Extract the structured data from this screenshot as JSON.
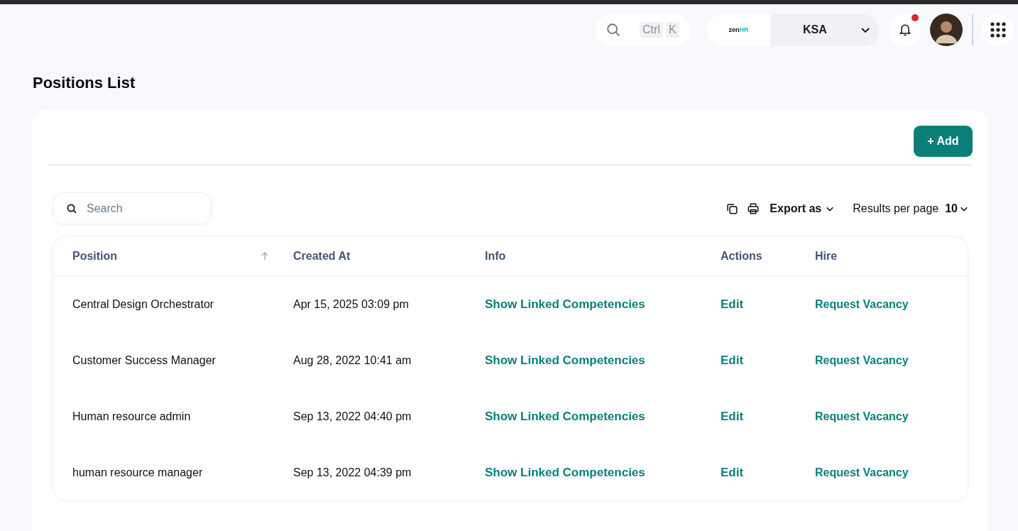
{
  "topbar": {
    "search_shortcut": [
      "Ctrl",
      "K"
    ],
    "logo": [
      "zen",
      "HR"
    ],
    "country": "KSA",
    "notifications": {
      "unread": true
    }
  },
  "page_title": "Positions List",
  "add_button": "+ Add",
  "search": {
    "placeholder": "Search"
  },
  "export_label": "Export as",
  "results_per_page": {
    "label": "Results per page",
    "value": "10"
  },
  "table": {
    "columns": [
      {
        "label": "Position",
        "sorted": true
      },
      {
        "label": "Created At",
        "sorted": false
      },
      {
        "label": "Info",
        "sorted": false
      },
      {
        "label": "Actions",
        "sorted": false
      },
      {
        "label": "Hire",
        "sorted": false
      }
    ],
    "rows": [
      {
        "position": "Central Design Orchestrator",
        "created_at": "Apr 15, 2025 03:09 pm",
        "info": "Show Linked Competencies",
        "action": "Edit",
        "hire": "Request Vacancy"
      },
      {
        "position": "Customer Success Manager",
        "created_at": "Aug 28, 2022 10:41 am",
        "info": "Show Linked Competencies",
        "action": "Edit",
        "hire": "Request Vacancy"
      },
      {
        "position": "Human resource admin",
        "created_at": "Sep 13, 2022 04:40 pm",
        "info": "Show Linked Competencies",
        "action": "Edit",
        "hire": "Request Vacancy"
      },
      {
        "position": "human resource manager",
        "created_at": "Sep 13, 2022 04:39 pm",
        "info": "Show Linked Competencies",
        "action": "Edit",
        "hire": "Request Vacancy"
      }
    ]
  }
}
